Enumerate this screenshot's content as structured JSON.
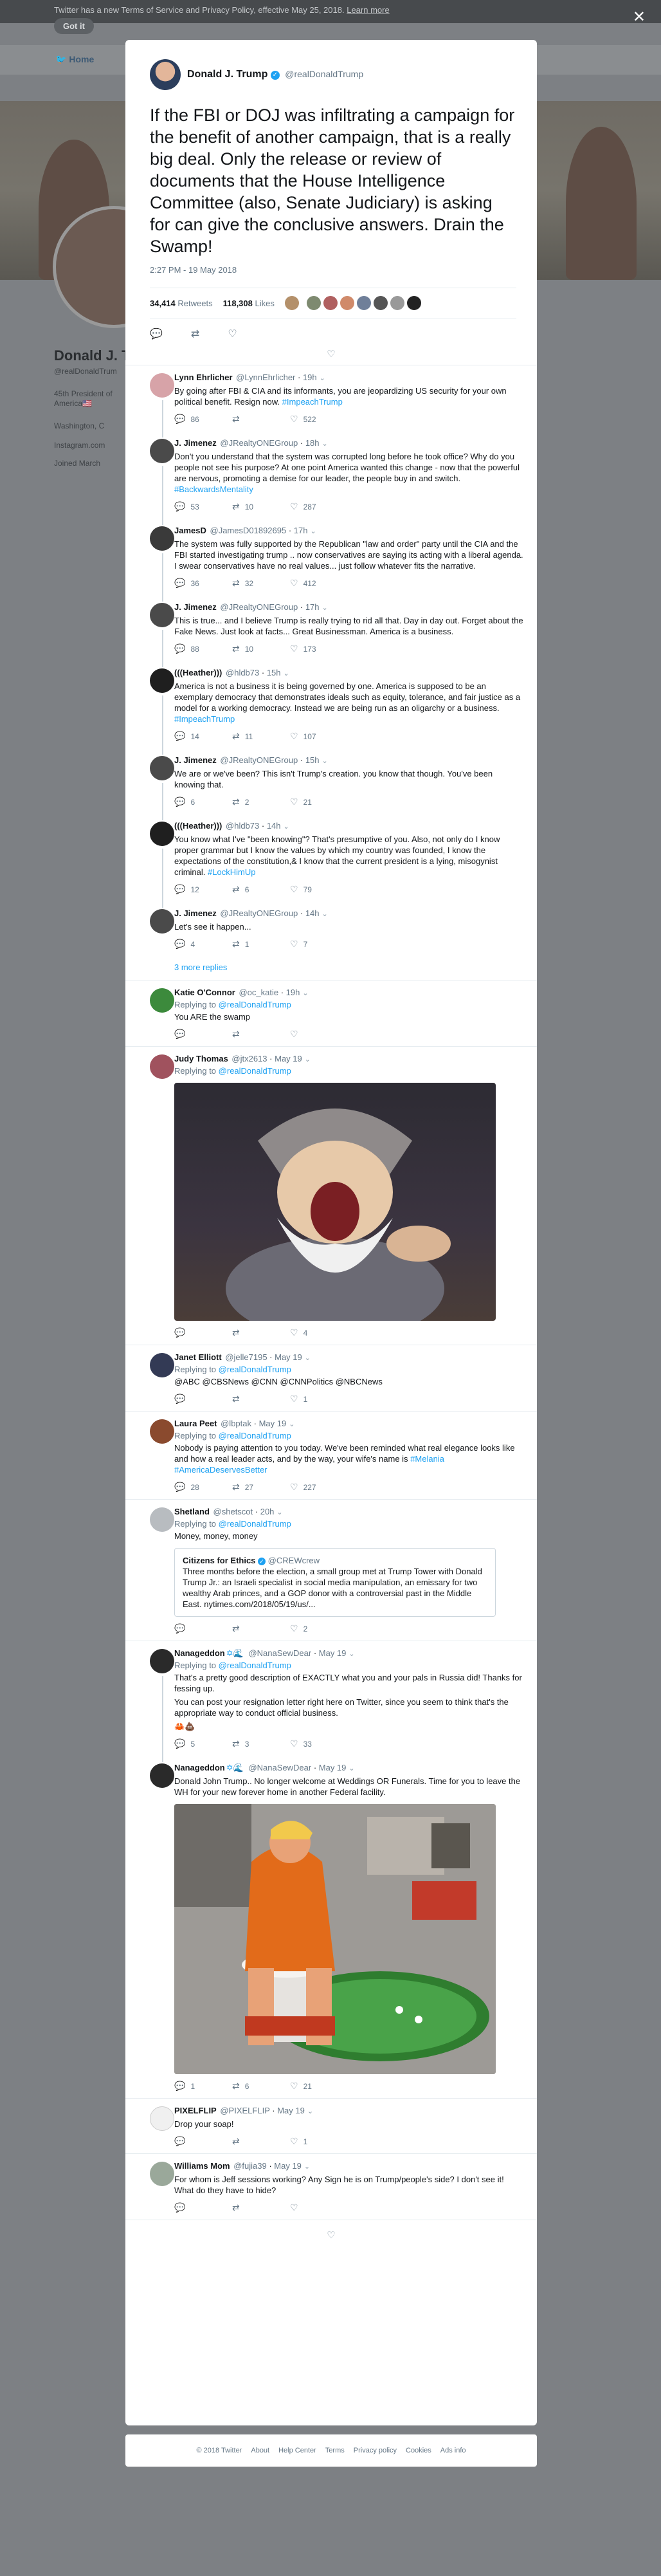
{
  "background": {
    "banner_text": "Twitter has a new Terms of Service and Privacy Policy, effective May 25, 2018.",
    "banner_link": "Learn more",
    "got_it": "Got it",
    "nav_home": "Home",
    "profile_name": "Donald J. T",
    "profile_handle": "@realDonaldTrum",
    "profile_bio1": "45th President of",
    "profile_bio2": "America🇺🇸",
    "profile_location": "Washington, C",
    "profile_link": "Instagram.com",
    "profile_joined": "Joined March"
  },
  "main_tweet": {
    "name": "Donald J. Trump",
    "handle": "@realDonaldTrump",
    "text": "If the FBI or DOJ was infiltrating a campaign for the benefit of another campaign, that is a really big deal. Only the release or review of documents that the House Intelligence Committee (also, Senate Judiciary) is asking for can give the conclusive answers. Drain the Swamp!",
    "time": "2:27 PM - 19 May 2018",
    "retweets": "34,414",
    "retweets_label": "Retweets",
    "likes": "118,308",
    "likes_label": "Likes"
  },
  "replies": [
    {
      "name": "Lynn Ehrlicher",
      "handle": "@LynnEhrlicher",
      "date": "19h",
      "body": "By going after FBI & CIA and its informants, you are jeopardizing US security for your own political benefit. Resign now.",
      "tag": "#ImpeachTrump",
      "reply": "86",
      "rt": "",
      "like": "522"
    },
    {
      "name": "J. Jimenez",
      "handle": "@JRealtyONEGroup",
      "date": "18h",
      "body": "Don't you understand that the system was corrupted long before he took office? Why do you people not see his purpose? At one point America wanted this change - now that the powerful are nervous, promoting a demise for our leader, the people buy in and switch.",
      "tag": "#BackwardsMentality",
      "reply": "53",
      "rt": "10",
      "like": "287"
    },
    {
      "name": "JamesD",
      "handle": "@JamesD01892695",
      "date": "17h",
      "body": "The system was fully supported by the Republican \"law and order\" party until the CIA and the FBI started investigating trump .. now conservatives are saying its acting with a liberal agenda. I swear conservatives have no real values... just follow whatever fits the narrative.",
      "tag": "",
      "reply": "36",
      "rt": "32",
      "like": "412"
    },
    {
      "name": "J. Jimenez",
      "handle": "@JRealtyONEGroup",
      "date": "17h",
      "body": "This is true... and I believe Trump is really trying to rid all that. Day in day out. Forget about the Fake News. Just look at facts... Great Businessman. America is a business.",
      "tag": "",
      "reply": "88",
      "rt": "10",
      "like": "173"
    },
    {
      "name": "(((Heather)))",
      "handle": "@hldb73",
      "date": "15h",
      "body": "America is not a business it is being governed by one. America is supposed to be an exemplary democracy that demonstrates ideals such as equity, tolerance, and fair justice as a model for a working democracy. Instead we are being run as an oligarchy or a business.",
      "tag": "#ImpeachTrump",
      "reply": "14",
      "rt": "11",
      "like": "107"
    },
    {
      "name": "J. Jimenez",
      "handle": "@JRealtyONEGroup",
      "date": "15h",
      "body": "We are or we've been? This isn't Trump's creation. you know that though. You've been knowing that.",
      "tag": "",
      "reply": "6",
      "rt": "2",
      "like": "21"
    },
    {
      "name": "(((Heather)))",
      "handle": "@hldb73",
      "date": "14h",
      "body": "You know what I've \"been knowing\"? That's presumptive of you. Also, not only do I know proper grammar but I know the values by which my country was founded, I know the expectations of the constitution,& I know that the current president is a lying, misogynist criminal.",
      "tag": "#LockHimUp",
      "reply": "12",
      "rt": "6",
      "like": "79"
    },
    {
      "name": "J. Jimenez",
      "handle": "@JRealtyONEGroup",
      "date": "14h",
      "body": "Let's see it happen...",
      "tag": "",
      "reply": "4",
      "rt": "1",
      "like": "7"
    }
  ],
  "more_replies": "3 more replies",
  "others": {
    "katie": {
      "name": "Katie O'Connor",
      "handle": "@oc_katie",
      "date": "19h",
      "replying": "Replying to",
      "to": "@realDonaldTrump",
      "body": "You ARE the swamp"
    },
    "judy": {
      "name": "Judy Thomas",
      "handle": "@jtx2613",
      "date": "May 19",
      "replying": "Replying to",
      "to": "@realDonaldTrump",
      "like": "4"
    },
    "janet": {
      "name": "Janet Elliott",
      "handle": "@jelle7195",
      "date": "May 19",
      "replying": "Replying to",
      "to": "@realDonaldTrump",
      "body": "@ABC @CBSNews @CNN @CNNPolitics @NBCNews",
      "like": "1"
    },
    "laura": {
      "name": "Laura Peet",
      "handle": "@lbptak",
      "date": "May 19",
      "replying": "Replying to",
      "to": "@realDonaldTrump",
      "body": "Nobody is paying attention to you today. We've been reminded what real elegance looks like and how a real leader acts, and by the way, your wife's name is",
      "tags": "#Melania #AmericaDeservesBetter",
      "reply": "28",
      "rt": "27",
      "like": "227"
    },
    "shetland": {
      "name": "Shetland",
      "handle": "@shetscot",
      "date": "20h",
      "replying": "Replying to",
      "to": "@realDonaldTrump",
      "body": "Money, money, money",
      "quote_name": "Citizens for Ethics",
      "quote_handle": "@CREWcrew",
      "quote_body": "Three months before the election, a small group met at Trump Tower with Donald Trump Jr.: an Israeli specialist in social media manipulation, an emissary for two wealthy Arab princes, and a GOP donor with a controversial past in the Middle East. nytimes.com/2018/05/19/us/...",
      "like": "2"
    },
    "nana1": {
      "name": "Nanageddon",
      "handle": "@NanaSewDear",
      "date": "May 19",
      "replying": "Replying to",
      "to": "@realDonaldTrump",
      "body1": "That's a pretty good description of EXACTLY what you and your pals in Russia did! Thanks for fessing up.",
      "body2": "You can post your resignation letter right here on Twitter, since you seem to think that's the appropriate way to conduct official business.",
      "reply": "5",
      "rt": "3",
      "like": "33"
    },
    "nana2": {
      "name": "Nanageddon",
      "handle": "@NanaSewDear",
      "date": "May 19",
      "body": "Donald John Trump.. No longer welcome at Weddings OR Funerals. Time for you to leave the WH for your new forever home in another Federal facility.",
      "reply": "1",
      "rt": "6",
      "like": "21"
    },
    "pixel": {
      "name": "PIXELFLIP",
      "handle": "@PIXELFLIP",
      "date": "May 19",
      "body": "Drop your soap!",
      "like": "1"
    },
    "williams": {
      "name": "Williams Mom",
      "handle": "@fujia39",
      "date": "May 19",
      "body": "For whom is Jeff sessions working? Any Sign he is on Trump/people's side? I don't see it! What do they have to hide?"
    }
  },
  "footer": [
    "© 2018 Twitter",
    "About",
    "Help Center",
    "Terms",
    "Privacy policy",
    "Cookies",
    "Ads info"
  ],
  "colors": {
    "accent": "#1da1f2",
    "verified": "#1da1f2",
    "muted": "#657786"
  }
}
